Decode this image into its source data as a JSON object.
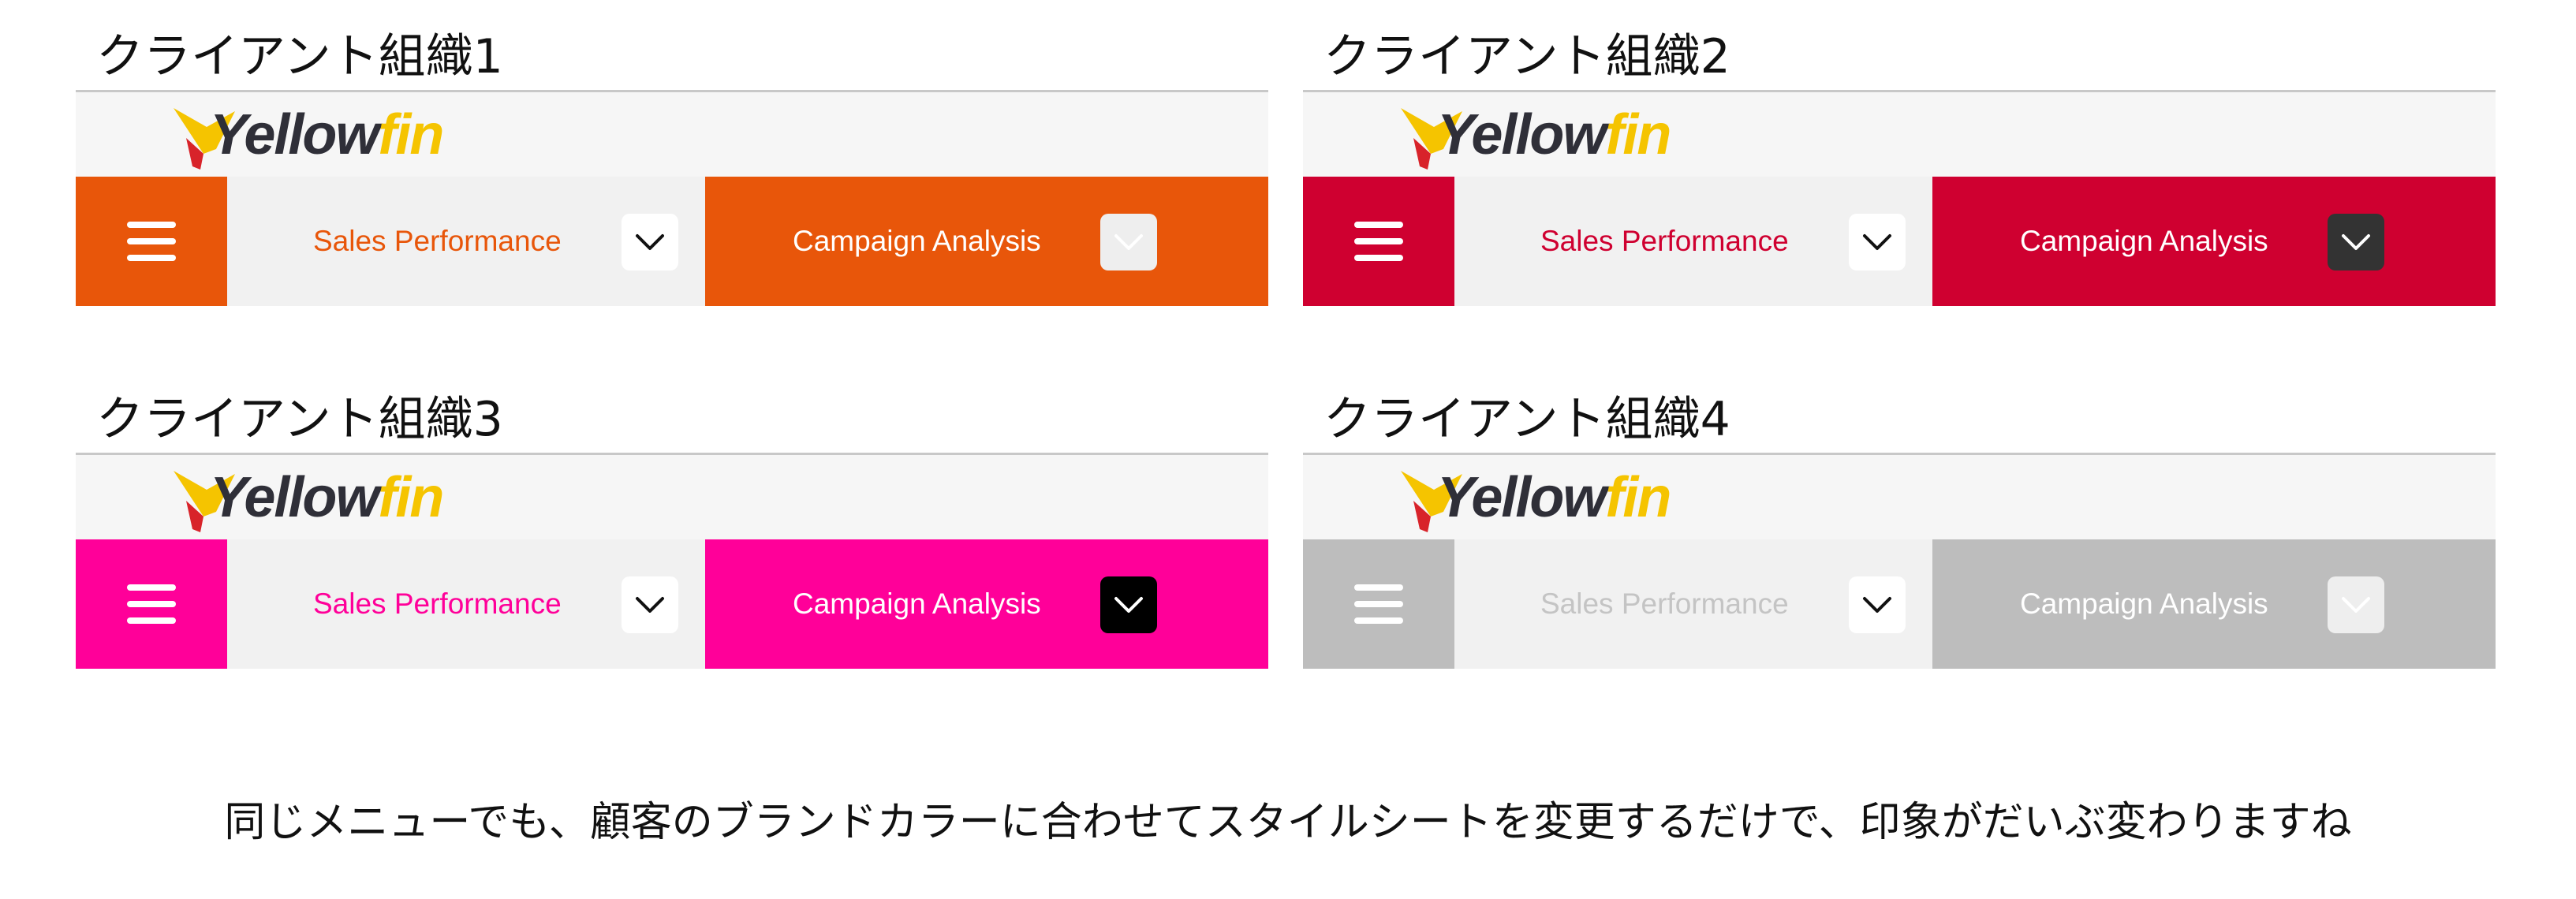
{
  "logo": {
    "part1": "Yellow",
    "part2": "fin"
  },
  "panels": [
    {
      "title": "クライアント組織1",
      "tab1_label": "Sales Performance",
      "tab2_label": "Campaign Analysis",
      "colors": {
        "brand": "#e8560a",
        "tab1_text": "#e8560a",
        "tab2_dd_bg": "#eeeeee",
        "tab2_dd_chevron": "#ffffff"
      }
    },
    {
      "title": "クライアント組織2",
      "tab1_label": "Sales Performance",
      "tab2_label": "Campaign Analysis",
      "colors": {
        "brand": "#cf0030",
        "tab1_text": "#cf0030",
        "tab2_dd_bg": "#333333",
        "tab2_dd_chevron": "#ffffff"
      }
    },
    {
      "title": "クライアント組織3",
      "tab1_label": "Sales Performance",
      "tab2_label": "Campaign Analysis",
      "colors": {
        "brand": "#ff0099",
        "tab1_text": "#ff0099",
        "tab2_dd_bg": "#000000",
        "tab2_dd_chevron": "#ffffff"
      }
    },
    {
      "title": "クライアント組織4",
      "tab1_label": "Sales Performance",
      "tab2_label": "Campaign Analysis",
      "colors": {
        "brand": "#bdbdbd",
        "tab1_text": "#c4c4c4",
        "tab2_dd_bg": "#eeeeee",
        "tab2_dd_chevron": "#ffffff"
      }
    }
  ],
  "caption": "同じメニューでも、顧客のブランドカラーに合わせてスタイルシートを変更するだけで、印象がだいぶ変わりますね"
}
